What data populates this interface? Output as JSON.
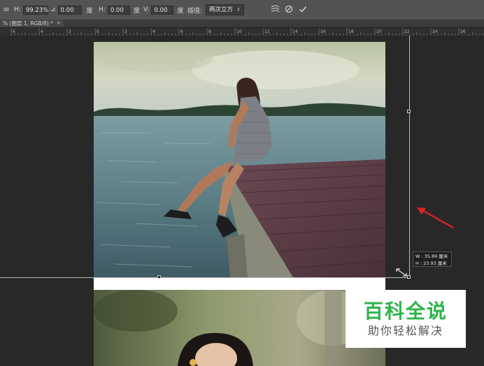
{
  "options_bar": {
    "h_label": "H:",
    "h_scale": "99.23%",
    "angle_value": "0.00",
    "angle_unit": "度",
    "hskew_label": "H:",
    "hskew_value": "0.00",
    "hskew_unit": "度",
    "vskew_label": "V:",
    "vskew_value": "0.00",
    "vskew_unit": "度",
    "interp_label": "插值:",
    "interp_value": "两次立方"
  },
  "document_tab": {
    "title": "% (图层 1, RGB/8) *",
    "close": "×"
  },
  "ruler": {
    "labels": [
      "6",
      "4",
      "2",
      "0",
      "2",
      "4",
      "6",
      "8",
      "10",
      "12",
      "14",
      "16",
      "18",
      "20",
      "22",
      "24",
      "26"
    ]
  },
  "size_readout": {
    "w_line": "W : 35.89 厘米",
    "h_line": "H : 23.93 厘米"
  },
  "watermark": {
    "title": "百科全说",
    "subtitle": "助你轻松解决"
  },
  "colors": {
    "arrow": "#e02424",
    "watermark_green": "#2db34a"
  }
}
